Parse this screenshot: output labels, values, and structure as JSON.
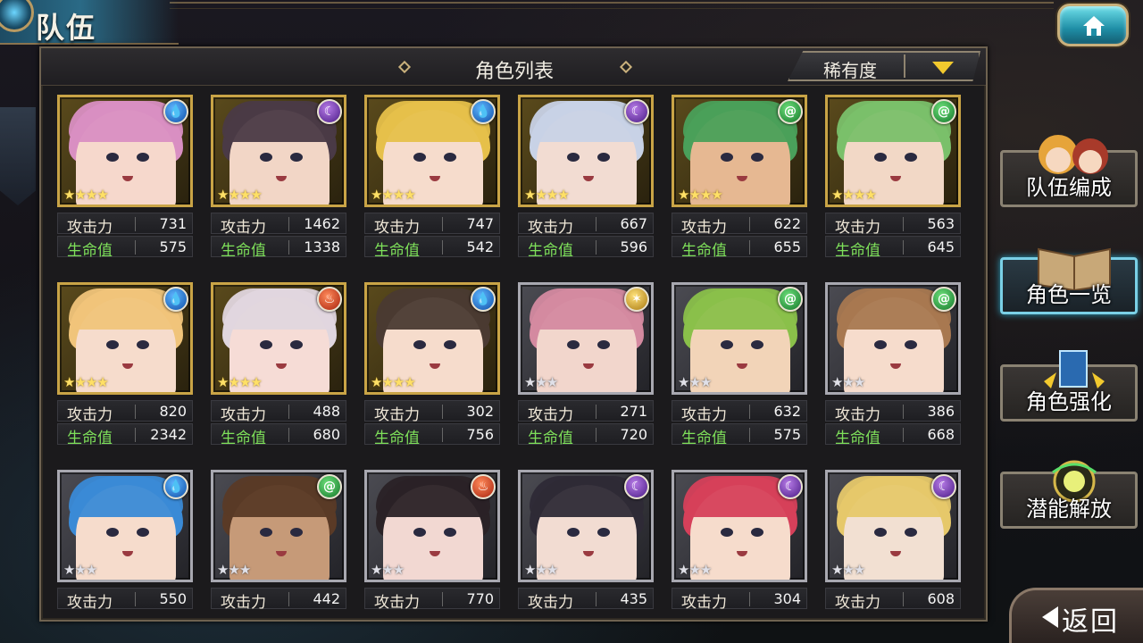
{
  "header": {
    "title": "队伍"
  },
  "panel": {
    "title": "角色列表",
    "sort": {
      "label": "稀有度"
    }
  },
  "labels": {
    "atk": "攻击力",
    "hp": "生命值"
  },
  "characters": [
    {
      "element": "water",
      "rarity": "gold",
      "stars": 4,
      "atk": "731",
      "hp": "575",
      "hair": "#d98fc2",
      "skin": "#f6d8cc"
    },
    {
      "element": "dark",
      "rarity": "gold",
      "stars": 4,
      "atk": "1462",
      "hp": "1338",
      "hair": "#4a3a46",
      "skin": "#f2d6c6"
    },
    {
      "element": "water",
      "rarity": "gold",
      "stars": 4,
      "atk": "747",
      "hp": "542",
      "hair": "#e6c04a",
      "skin": "#f6dccc"
    },
    {
      "element": "dark",
      "rarity": "gold",
      "stars": 4,
      "atk": "667",
      "hp": "596",
      "hair": "#c8d2e6",
      "skin": "#f2dcd2"
    },
    {
      "element": "wind",
      "rarity": "gold",
      "stars": 4,
      "atk": "622",
      "hp": "655",
      "hair": "#4aa05a",
      "skin": "#e6b892"
    },
    {
      "element": "wind",
      "rarity": "gold",
      "stars": 4,
      "atk": "563",
      "hp": "645",
      "hair": "#7ac06a",
      "skin": "#f2d8c6"
    },
    {
      "element": "water",
      "rarity": "gold",
      "stars": 4,
      "atk": "820",
      "hp": "2342",
      "hair": "#f0c47a",
      "skin": "#f6dccc"
    },
    {
      "element": "fire",
      "rarity": "gold",
      "stars": 4,
      "atk": "488",
      "hp": "680",
      "hair": "#e0d6de",
      "skin": "#f6dcd6"
    },
    {
      "element": "water",
      "rarity": "gold",
      "stars": 4,
      "atk": "302",
      "hp": "756",
      "hair": "#4a3a32",
      "skin": "#f6dccc"
    },
    {
      "element": "light",
      "rarity": "silver",
      "stars": 3,
      "atk": "271",
      "hp": "720",
      "hair": "#d48aa0",
      "skin": "#f2d6cc"
    },
    {
      "element": "wind",
      "rarity": "silver",
      "stars": 3,
      "atk": "632",
      "hp": "575",
      "hair": "#8ac04a",
      "skin": "#f2d4b8"
    },
    {
      "element": "wind",
      "rarity": "silver",
      "stars": 3,
      "atk": "386",
      "hp": "668",
      "hair": "#a87850",
      "skin": "#f6dccc"
    },
    {
      "element": "water",
      "rarity": "silver",
      "stars": 3,
      "atk": "550",
      "hp": "",
      "hair": "#3a8ad6",
      "skin": "#f6dccc"
    },
    {
      "element": "wind",
      "rarity": "silver",
      "stars": 3,
      "atk": "442",
      "hp": "",
      "hair": "#5a3a26",
      "skin": "#c69a78"
    },
    {
      "element": "fire",
      "rarity": "silver",
      "stars": 3,
      "atk": "770",
      "hp": "",
      "hair": "#2a2226",
      "skin": "#f2d8d2"
    },
    {
      "element": "dark",
      "rarity": "silver",
      "stars": 3,
      "atk": "435",
      "hp": "",
      "hair": "#2e2a36",
      "skin": "#f2dcd2"
    },
    {
      "element": "dark",
      "rarity": "silver",
      "stars": 3,
      "atk": "304",
      "hp": "",
      "hair": "#d6405a",
      "skin": "#f6dccc"
    },
    {
      "element": "dark",
      "rarity": "silver",
      "stars": 3,
      "atk": "608",
      "hp": "",
      "hair": "#e6c86a",
      "skin": "#f2e0d2"
    }
  ],
  "side_menu": [
    {
      "label": "队伍编成",
      "active": false
    },
    {
      "label": "角色一览",
      "active": true
    },
    {
      "label": "角色强化",
      "active": false
    },
    {
      "label": "潜能解放",
      "active": false
    }
  ],
  "back": {
    "label": "返回"
  },
  "icons": {
    "home": "home-icon",
    "sort": "dropdown-arrow-icon",
    "back": "back-arrow-icon"
  }
}
